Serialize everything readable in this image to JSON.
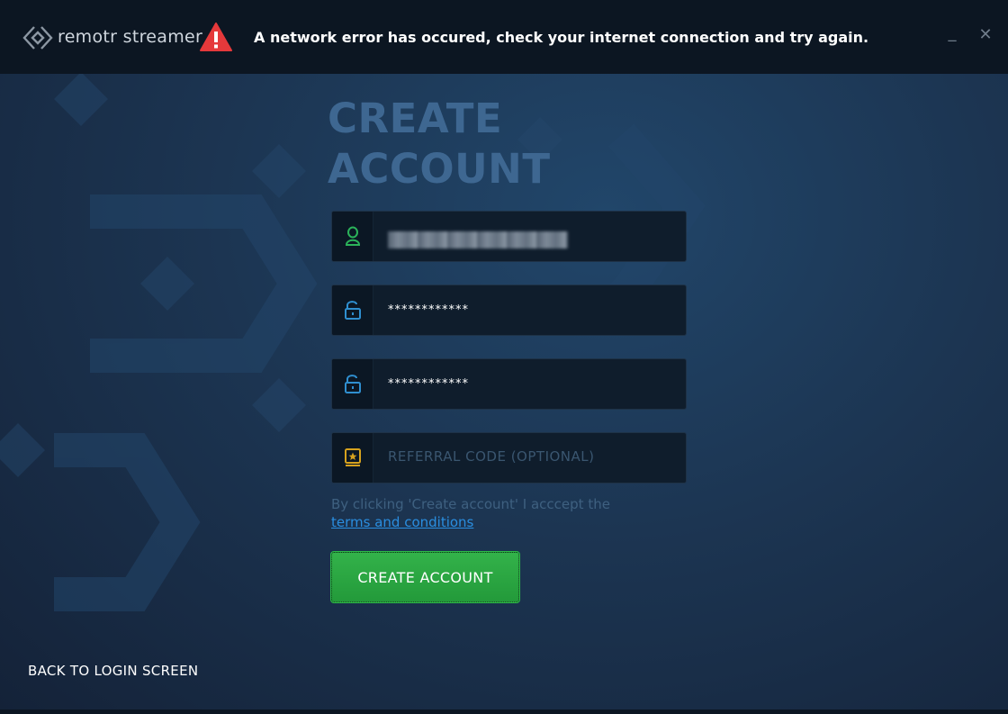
{
  "titlebar": {
    "app_name": "remotr streamer",
    "error_message": "A network error has occured, check your internet connection and try again.",
    "minimize_label": "_",
    "close_label": "✕"
  },
  "page": {
    "heading_line1": "CREATE",
    "heading_line2": "ACCOUNT"
  },
  "form": {
    "username_value": "",
    "password_value": "************",
    "confirm_password_value": "************",
    "referral_placeholder": "REFERRAL CODE (OPTIONAL)",
    "icons": {
      "username": "user-icon",
      "password": "unlock-icon",
      "confirm_password": "unlock-icon",
      "referral": "referral-badge-icon"
    }
  },
  "terms": {
    "text_prefix": "By clicking 'Create account' I acccept the ",
    "link_text": "terms and conditions"
  },
  "actions": {
    "create_label": "CREATE ACCOUNT",
    "back_label": "BACK TO LOGIN SCREEN"
  },
  "colors": {
    "accent_green": "#2eab45",
    "icon_green": "#2bb35a",
    "icon_blue": "#2f8fd0",
    "icon_gold": "#d6a21e",
    "error_red": "#e5393b",
    "heading": "#3e6791",
    "link": "#2a8ee0"
  }
}
